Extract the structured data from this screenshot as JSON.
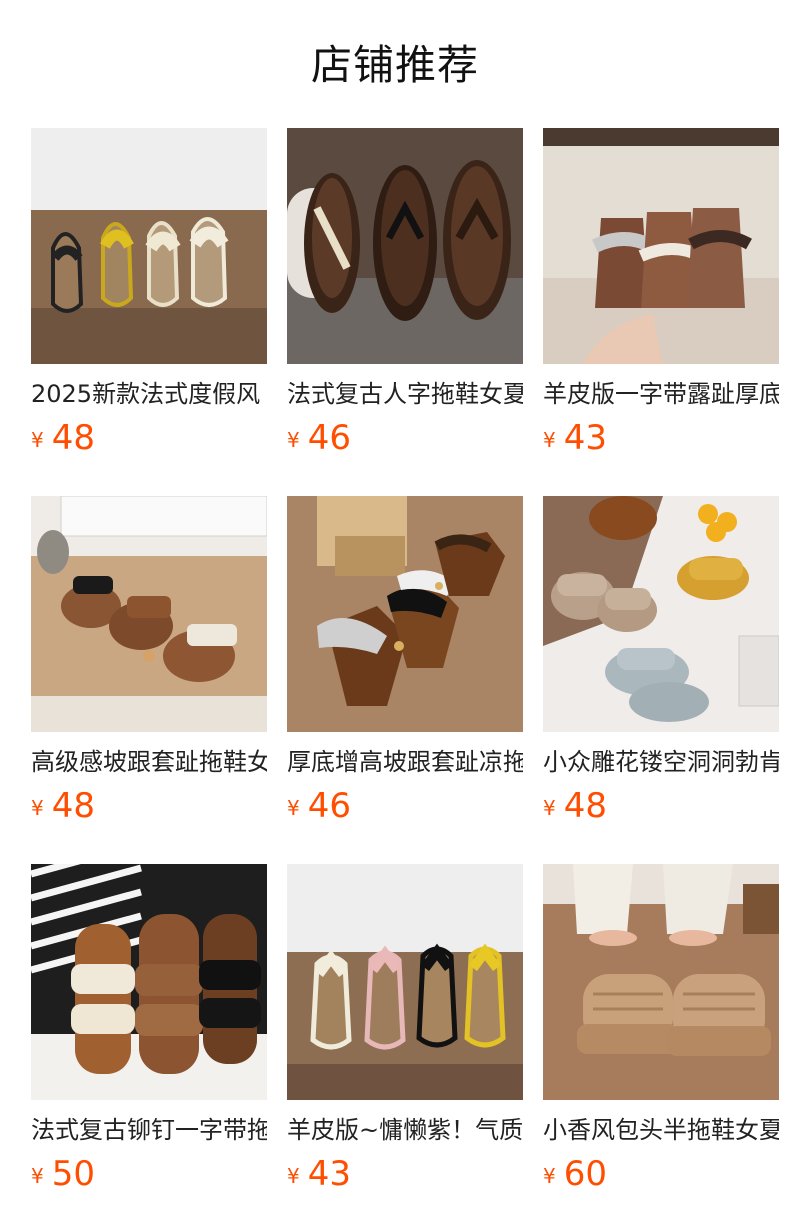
{
  "section": {
    "title": "店铺推荐"
  },
  "products": [
    {
      "title": "2025新款法式度假风",
      "currency": "¥",
      "price": "48",
      "image": "flip-flops-four-colors-on-shelf"
    },
    {
      "title": "法式复古人字拖鞋女夏",
      "currency": "¥",
      "price": "46",
      "image": "brown-wooden-sole-sandals"
    },
    {
      "title": "羊皮版一字带露趾厚底",
      "currency": "¥",
      "price": "43",
      "image": "twisted-strap-slides-in-hand"
    },
    {
      "title": "高级感坡跟套趾拖鞋女",
      "currency": "¥",
      "price": "48",
      "image": "toe-loop-wedge-slippers-on-shelf"
    },
    {
      "title": "厚底增高坡跟套趾凉拖",
      "currency": "¥",
      "price": "46",
      "image": "metallic-toe-post-sandals-with-box"
    },
    {
      "title": "小众雕花镂空洞洞勃肯",
      "currency": "¥",
      "price": "48",
      "image": "perforated-platform-slides"
    },
    {
      "title": "法式复古铆钉一字带拖",
      "currency": "¥",
      "price": "50",
      "image": "studded-strap-slides-in-hand"
    },
    {
      "title": "羊皮版~慵懒紫！气质",
      "currency": "¥",
      "price": "43",
      "image": "thong-sandals-four-colors"
    },
    {
      "title": "小香风包头半拖鞋女夏",
      "currency": "¥",
      "price": "60",
      "image": "woven-platform-mules-on-feet"
    }
  ]
}
